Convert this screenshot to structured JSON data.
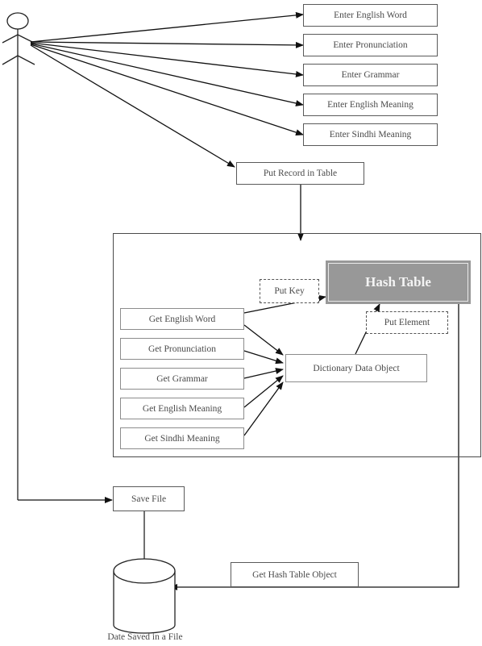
{
  "diagram": {
    "actor": {
      "name": "user-actor"
    },
    "input_boxes": [
      {
        "label": "Enter English Word"
      },
      {
        "label": "Enter Pronunciation"
      },
      {
        "label": "Enter Grammar"
      },
      {
        "label": "Enter English Meaning"
      },
      {
        "label": "Enter Sindhi Meaning"
      }
    ],
    "put_record": {
      "label": "Put Record in Table"
    },
    "get_boxes": [
      {
        "label": "Get English Word"
      },
      {
        "label": "Get Pronunciation"
      },
      {
        "label": "Get Grammar"
      },
      {
        "label": "Get English Meaning"
      },
      {
        "label": "Get Sindhi Meaning"
      }
    ],
    "put_key": {
      "label": "Put Key"
    },
    "hash_table": {
      "label": "Hash Table",
      "color": "#989898"
    },
    "put_element": {
      "label": "Put Element"
    },
    "dictionary_object": {
      "label": "Dictionary Data Object"
    },
    "save_file": {
      "label": "Save File"
    },
    "get_hash_table_object": {
      "label": "Get Hash Table Object"
    },
    "storage": {
      "label": "Date Saved in a File"
    }
  }
}
